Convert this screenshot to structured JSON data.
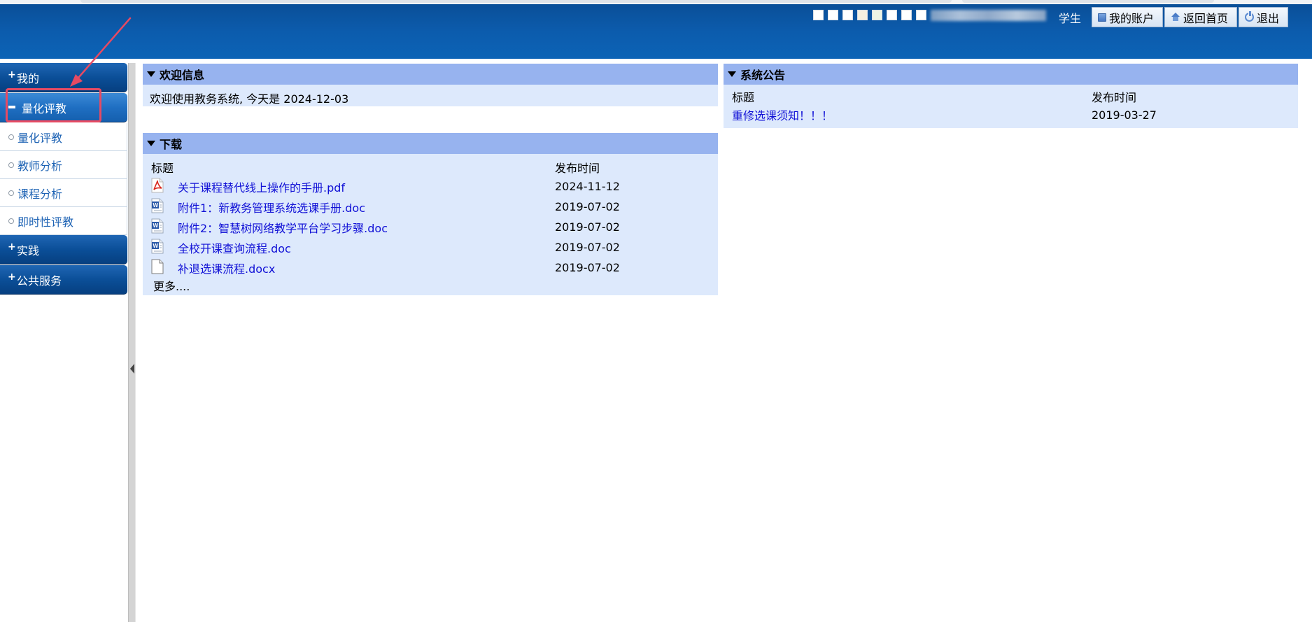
{
  "header": {
    "role": "学生",
    "buttons": {
      "account": "我的账户",
      "home": "返回首页",
      "logout": "退出"
    }
  },
  "sidebar": {
    "sections": [
      {
        "label": "我的",
        "expanded": false
      },
      {
        "label": "量化评教",
        "expanded": true
      },
      {
        "label": "实践",
        "expanded": false
      },
      {
        "label": "公共服务",
        "expanded": false
      }
    ],
    "sub_items": [
      "量化评教",
      "教师分析",
      "课程分析",
      "即时性评教"
    ]
  },
  "welcome": {
    "title": "欢迎信息",
    "text": "欢迎使用教务系统, 今天是 2024-12-03"
  },
  "downloads": {
    "title": "下载",
    "col_title": "标题",
    "col_date": "发布时间",
    "rows": [
      {
        "name": "关于课程替代线上操作的手册.pdf",
        "date": "2024-11-12",
        "icon": "pdf-icon"
      },
      {
        "name": "附件1：新教务管理系统选课手册.doc",
        "date": "2019-07-02",
        "icon": "word-doc-icon"
      },
      {
        "name": "附件2：智慧树网络教学平台学习步骤.doc",
        "date": "2019-07-02",
        "icon": "word-doc-icon"
      },
      {
        "name": "全校开课查询流程.doc",
        "date": "2019-07-02",
        "icon": "word-doc-icon"
      },
      {
        "name": "补退选课流程.docx",
        "date": "2019-07-02",
        "icon": "blank-file-icon"
      }
    ],
    "more": "更多...."
  },
  "notice": {
    "title": "系统公告",
    "col_title": "标题",
    "col_date": "发布时间",
    "rows": [
      {
        "name": "重修选课须知！！！",
        "date": "2019-03-27"
      }
    ]
  },
  "colors": {
    "banner": "#0c5cad",
    "panel_header": "#97b3ef",
    "panel_body": "#dde9fc",
    "link": "#1010d6",
    "highlight": "#e64a63"
  }
}
